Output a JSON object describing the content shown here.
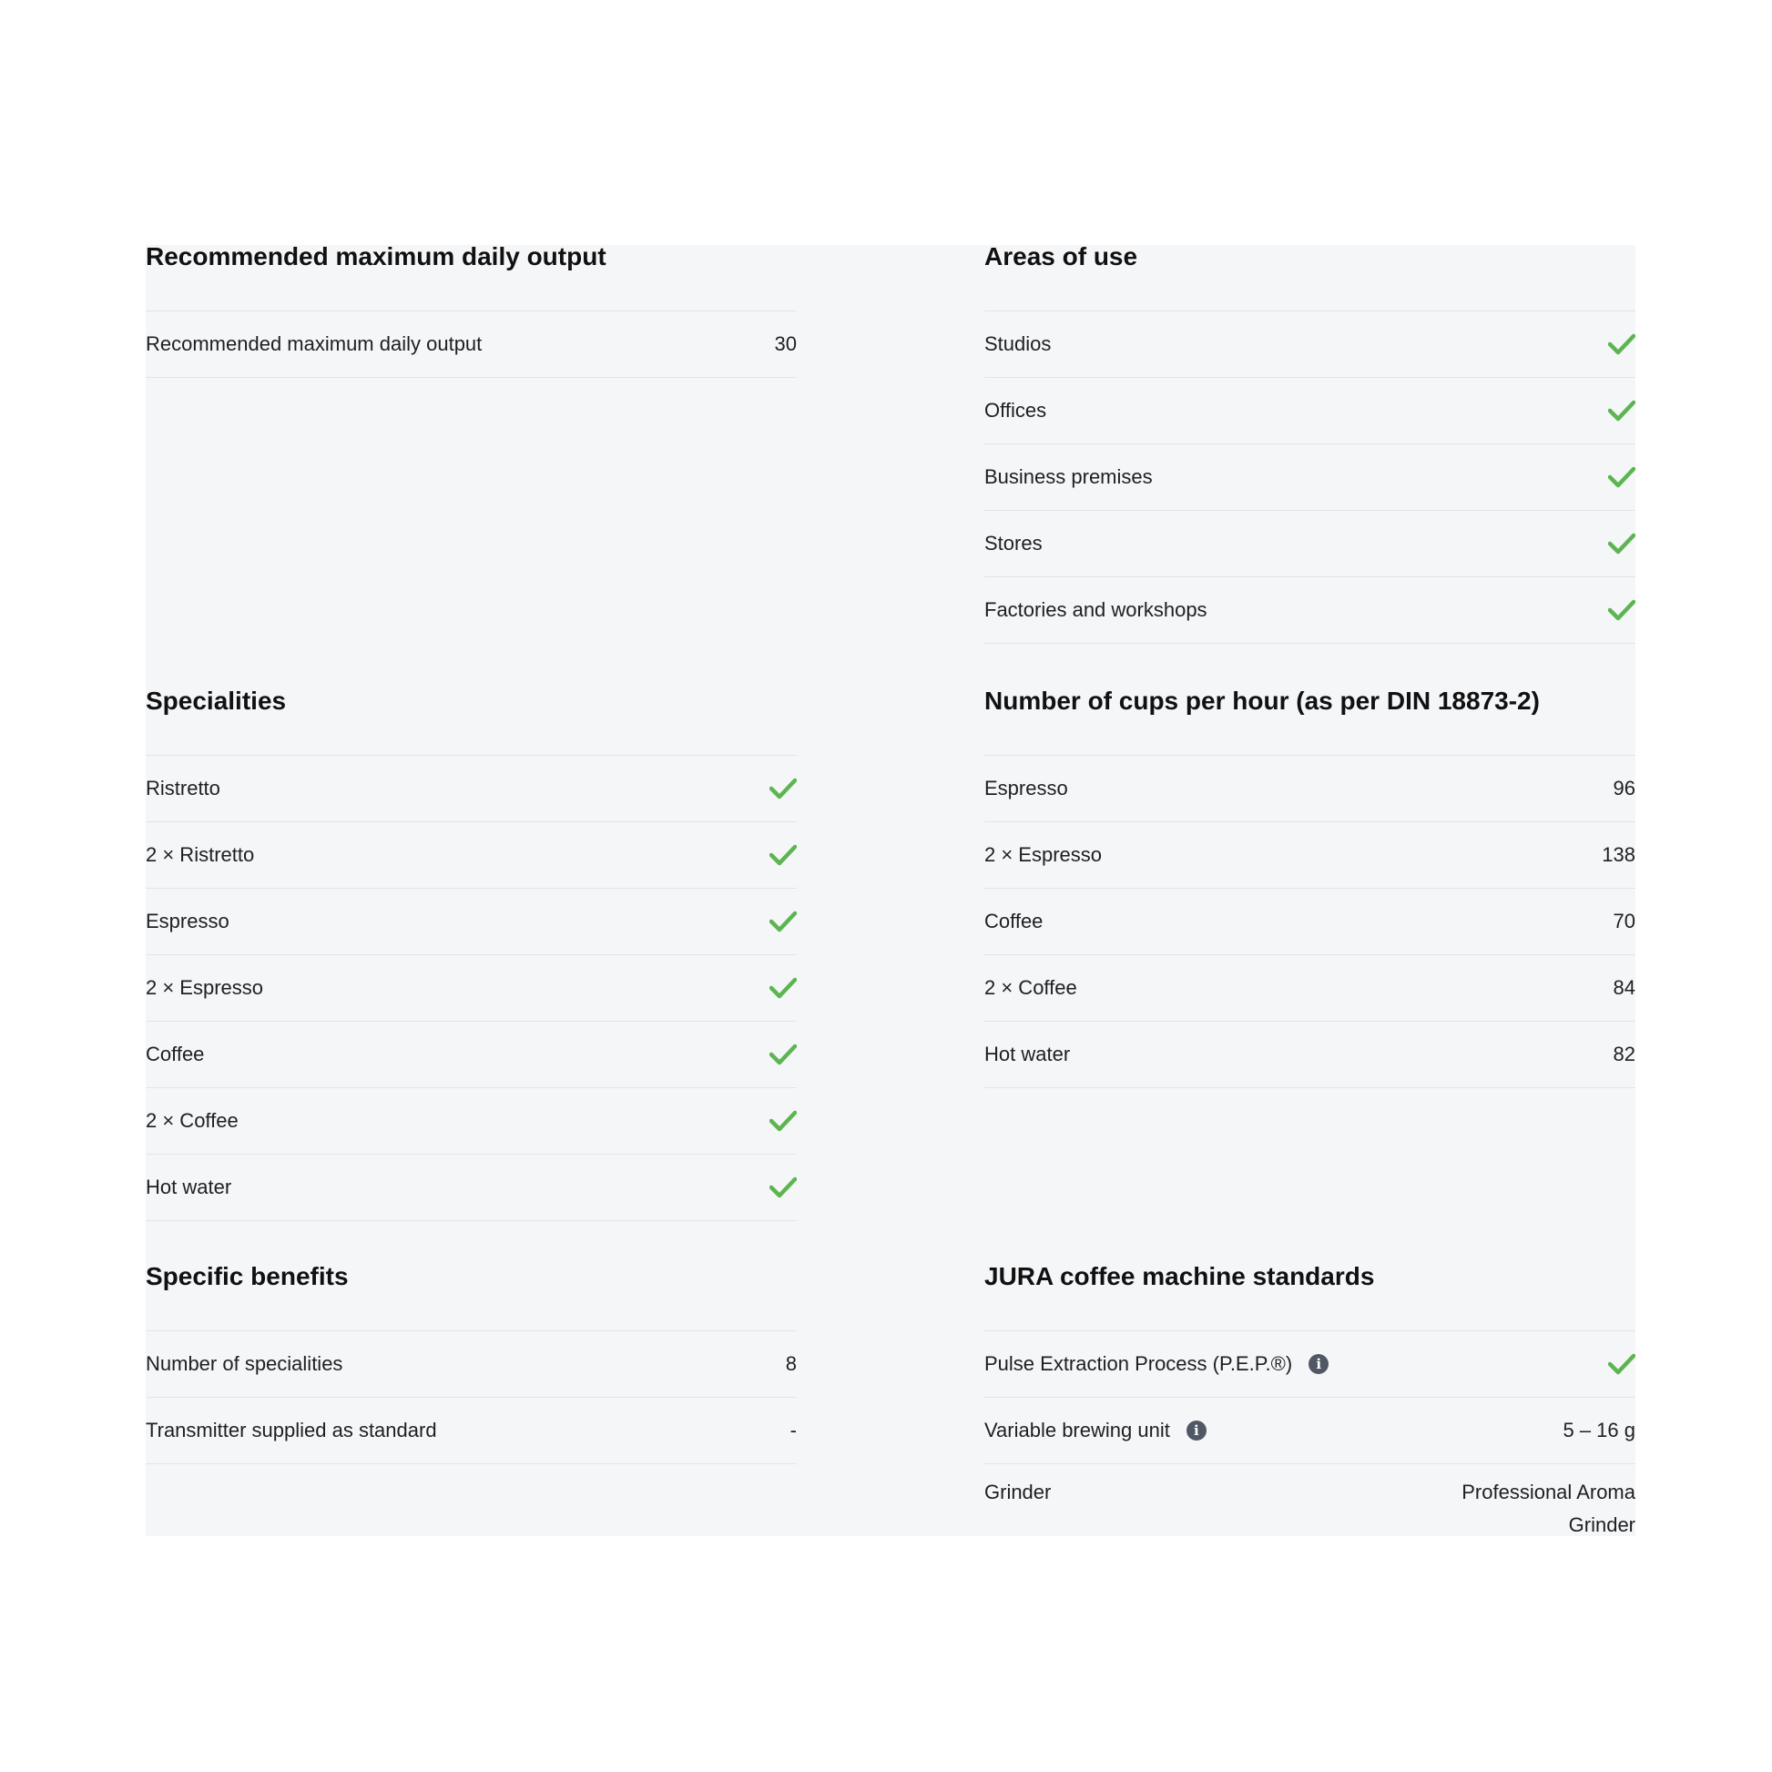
{
  "colors": {
    "check": "#5cb551",
    "panel": "#f5f6f8",
    "info": "#4f5864"
  },
  "sections": [
    {
      "title": "Recommended maximum daily output",
      "rows": [
        {
          "label": "Recommended maximum daily output",
          "value": "30"
        }
      ]
    },
    {
      "title": "Areas of use",
      "rows": [
        {
          "label": "Studios",
          "value": "check-icon"
        },
        {
          "label": "Offices",
          "value": "check-icon"
        },
        {
          "label": "Business premises",
          "value": "check-icon"
        },
        {
          "label": "Stores",
          "value": "check-icon"
        },
        {
          "label": "Factories and workshops",
          "value": "check-icon"
        }
      ]
    },
    {
      "title": "Specialities",
      "rows": [
        {
          "label": "Ristretto",
          "value": "check-icon"
        },
        {
          "label": "2 × Ristretto",
          "value": "check-icon"
        },
        {
          "label": "Espresso",
          "value": "check-icon"
        },
        {
          "label": "2 × Espresso",
          "value": "check-icon"
        },
        {
          "label": "Coffee",
          "value": "check-icon"
        },
        {
          "label": "2 × Coffee",
          "value": "check-icon"
        },
        {
          "label": "Hot water",
          "value": "check-icon"
        }
      ]
    },
    {
      "title": "Number of cups per hour (as per DIN 18873-2)",
      "rows": [
        {
          "label": "Espresso",
          "value": "96"
        },
        {
          "label": "2 × Espresso",
          "value": "138"
        },
        {
          "label": "Coffee",
          "value": "70"
        },
        {
          "label": "2 × Coffee",
          "value": "84"
        },
        {
          "label": "Hot water",
          "value": "82"
        }
      ]
    },
    {
      "title": "Specific benefits",
      "rows": [
        {
          "label": "Number of specialities",
          "value": "8"
        },
        {
          "label": "Transmitter supplied as standard",
          "value": "-"
        }
      ]
    },
    {
      "title": "JURA coffee machine standards",
      "rows": [
        {
          "label": "Pulse Extraction Process (P.E.P.®)",
          "info": true,
          "value": "check-icon"
        },
        {
          "label": "Variable brewing unit",
          "info": true,
          "value": "5 – 16 g"
        },
        {
          "label": "Grinder",
          "value": "Professional Aroma Grinder"
        }
      ]
    }
  ]
}
